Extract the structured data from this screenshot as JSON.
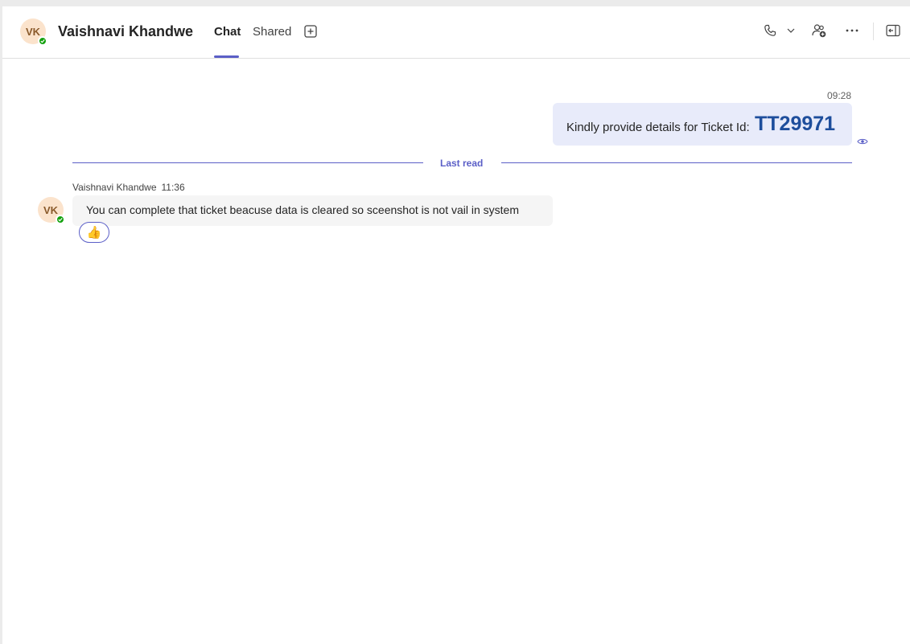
{
  "header": {
    "avatar_initials": "VK",
    "title": "Vaishnavi Khandwe",
    "tabs": [
      {
        "label": "Chat",
        "active": true
      },
      {
        "label": "Shared",
        "active": false
      }
    ],
    "icons": [
      "add-tab-icon",
      "call-icon",
      "chevron-down-icon",
      "add-people-icon",
      "more-icon",
      "pop-out-icon"
    ]
  },
  "messages": {
    "outgoing": {
      "time": "09:28",
      "text": "Kindly provide details for Ticket Id:",
      "ticket": "TT29971",
      "status_icon": "seen-icon"
    },
    "last_read_label": "Last read",
    "incoming": {
      "sender": "Vaishnavi Khandwe",
      "time": "11:36",
      "avatar_initials": "VK",
      "text": "You can complete that ticket beacuse data is cleared so sceenshot is not vail in system",
      "reaction": "👍"
    }
  },
  "colors": {
    "accent": "#5b5fc7",
    "presence": "#13a10e",
    "ticket_text": "#1e4e9c",
    "outgoing_bubble": "#e8ebfa",
    "incoming_bubble": "#f5f5f5"
  }
}
